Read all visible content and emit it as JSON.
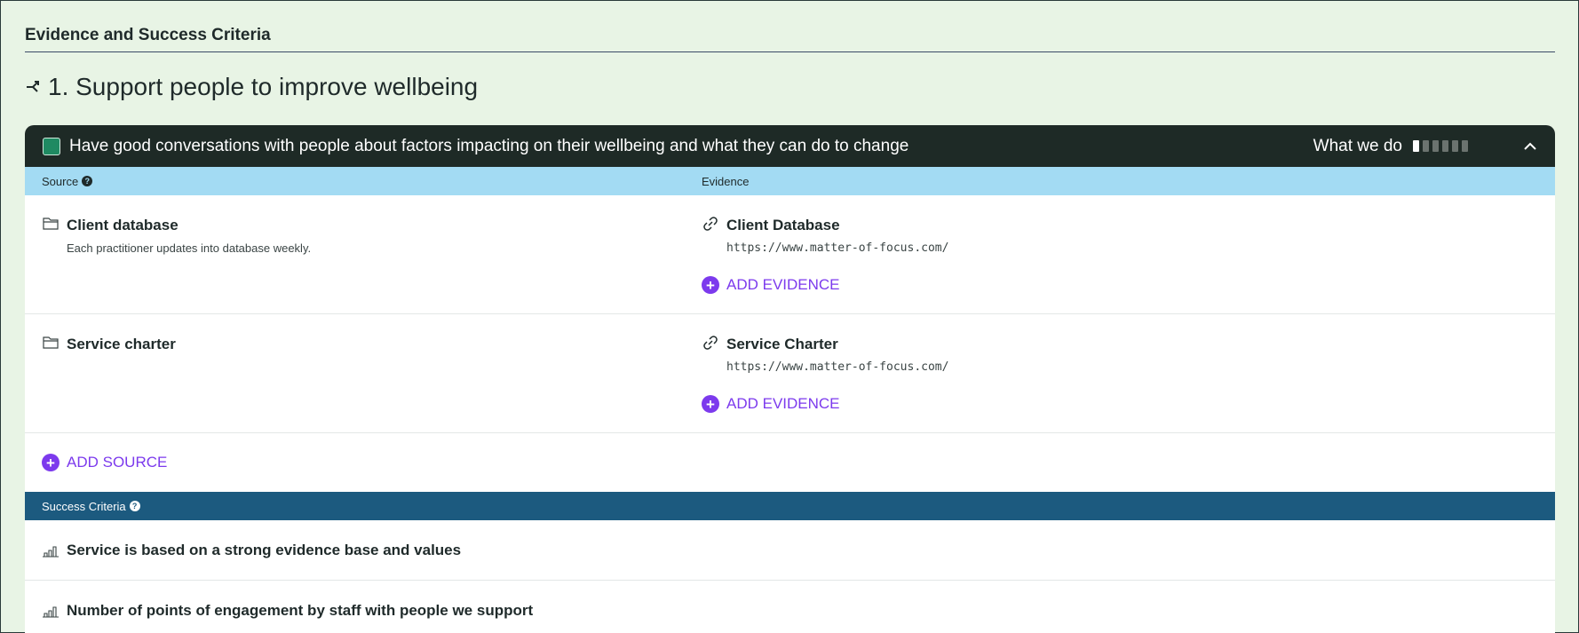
{
  "page": {
    "heading": "Evidence and Success Criteria",
    "outcome_title": "1. Support people to improve wellbeing"
  },
  "card": {
    "title": "Have good conversations with people about factors impacting on their wellbeing and what they can do to change",
    "meta_label": "What we do",
    "progress": {
      "filled": 1,
      "total": 6
    },
    "accent_color": "#1f8a62"
  },
  "columns": {
    "source": "Source",
    "evidence": "Evidence"
  },
  "sources": [
    {
      "name": "Client database",
      "description": "Each practitioner updates into database weekly.",
      "evidence": [
        {
          "name": "Client Database",
          "url": "https://www.matter-of-focus.com/"
        }
      ],
      "add_evidence_label": "ADD EVIDENCE"
    },
    {
      "name": "Service charter",
      "description": "",
      "evidence": [
        {
          "name": "Service Charter",
          "url": "https://www.matter-of-focus.com/"
        }
      ],
      "add_evidence_label": "ADD EVIDENCE"
    }
  ],
  "add_source_label": "ADD SOURCE",
  "success_criteria": {
    "header": "Success Criteria",
    "items": [
      "Service is based on a strong evidence base and values",
      "Number of points of engagement by staff with people we support"
    ]
  },
  "icons": {
    "outcome": "branch-icon",
    "source": "folder-icon",
    "evidence": "link-icon",
    "criteria": "bar-chart-icon",
    "help": "question-icon",
    "collapse": "chevron-up-icon"
  }
}
